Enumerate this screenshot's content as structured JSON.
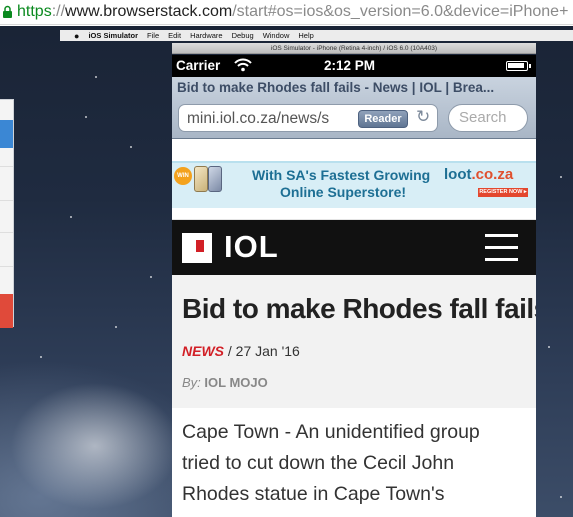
{
  "browser": {
    "url_scheme": "https",
    "url_separator": "://",
    "url_domain": "www.browserstack.com",
    "url_path": "/start#os=ios&os_version=6.0&device=iPhone+"
  },
  "mac_menubar": {
    "apple": "",
    "items": [
      "iOS Simulator",
      "File",
      "Edit",
      "Hardware",
      "Debug",
      "Window",
      "Help"
    ]
  },
  "simulator": {
    "window_title": "iOS Simulator - iPhone (Retina 4-inch) / iOS 6.0 (10A403)"
  },
  "status_bar": {
    "carrier": "Carrier",
    "time": "2:12 PM"
  },
  "safari": {
    "page_title": "Bid to make Rhodes fall fails - News | IOL | Brea...",
    "address": "mini.iol.co.za/news/s",
    "reader_label": "Reader",
    "search_placeholder": "Search"
  },
  "ad": {
    "line1": "With SA's Fastest Growing",
    "line2": "Online Superstore!",
    "logo": "loot",
    "logo_suffix": ".co.za",
    "button": "REGISTER NOW ▸",
    "badge": "WIN"
  },
  "site": {
    "logo_text": "IOL"
  },
  "article": {
    "headline": "Bid to make Rhodes fall fails",
    "category": "NEWS",
    "date_sep": " / ",
    "date": "27 Jan '16",
    "by_prefix": "By: ",
    "author": "IOL MOJO",
    "body_lines": [
      "Cape Town - An unidentified group",
      "tried to cut down the Cecil John",
      "Rhodes statue in Cape Town's"
    ]
  },
  "colors": {
    "iol_red": "#d21f26",
    "https_green": "#0b8a1f",
    "safari_title": "#3d4d66"
  }
}
